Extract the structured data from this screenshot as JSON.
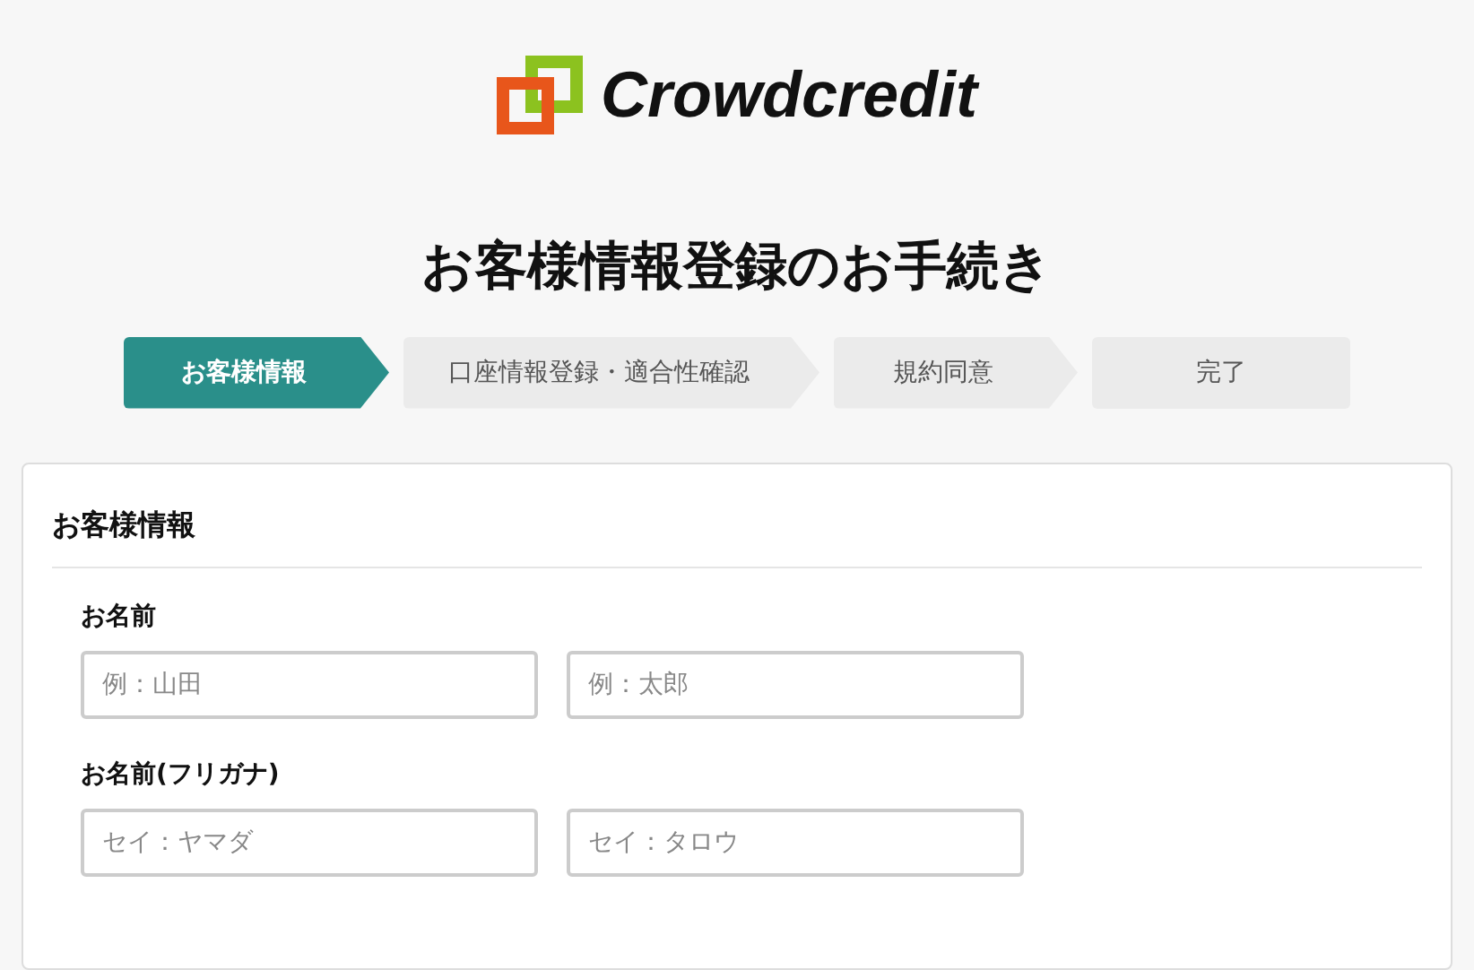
{
  "logo": {
    "text": "Crowdcredit"
  },
  "title": "お客様情報登録のお手続き",
  "steps": [
    {
      "label": "お客様情報",
      "selected": true
    },
    {
      "label": "口座情報登録・適合性確認",
      "selected": false
    },
    {
      "label": "規約同意",
      "selected": false
    },
    {
      "label": "完了",
      "selected": false
    }
  ],
  "section": {
    "title": "お客様情報",
    "fields": [
      {
        "label": "お名前",
        "inputs": [
          {
            "placeholder": "例：山田"
          },
          {
            "placeholder": "例：太郎"
          }
        ]
      },
      {
        "label": "お名前(フリガナ)",
        "inputs": [
          {
            "placeholder": "セイ：ヤマダ"
          },
          {
            "placeholder": "セイ：タロウ"
          }
        ]
      }
    ]
  }
}
